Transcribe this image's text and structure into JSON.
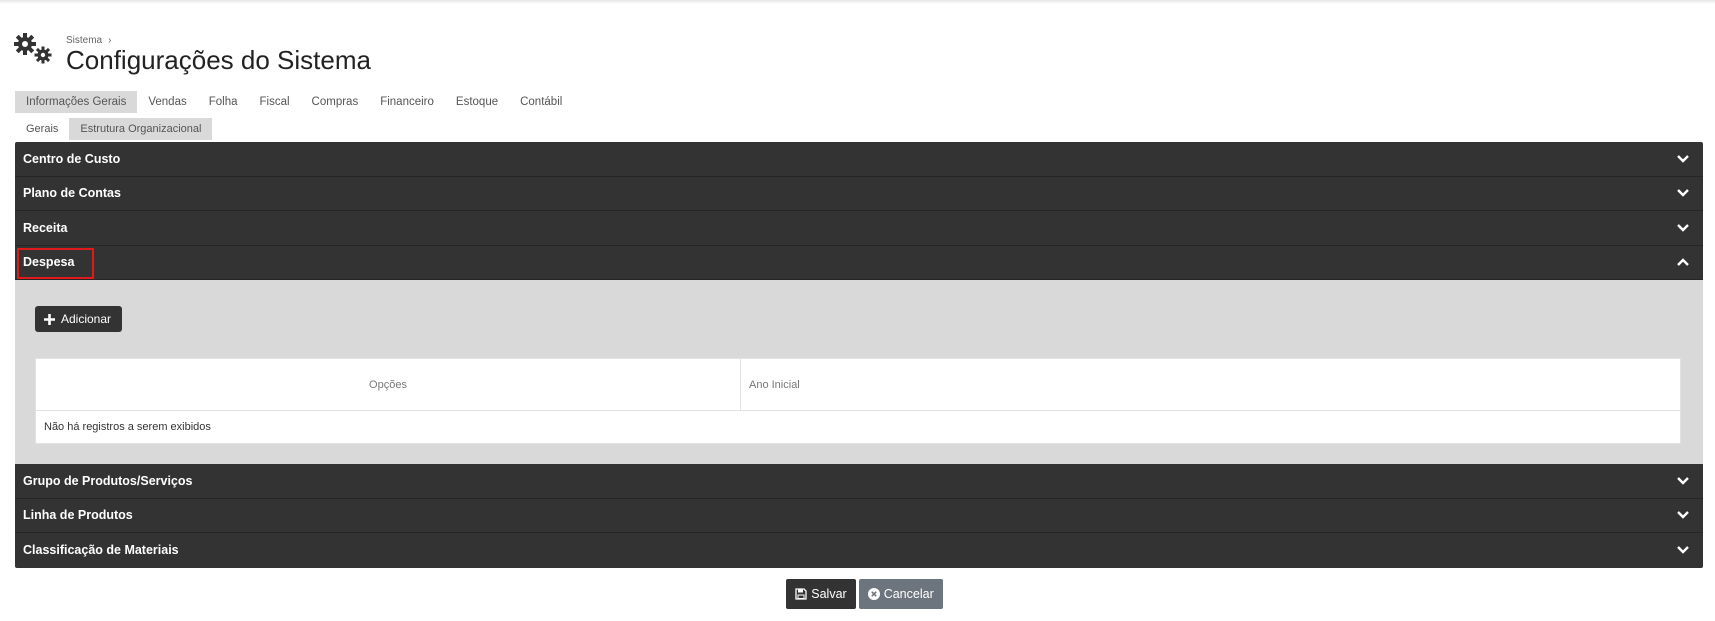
{
  "header": {
    "breadcrumb": "Sistema",
    "title": "Configurações do Sistema",
    "icon": "gears-icon"
  },
  "tabs": [
    {
      "label": "Informações Gerais",
      "active": true
    },
    {
      "label": "Vendas",
      "active": false
    },
    {
      "label": "Folha",
      "active": false
    },
    {
      "label": "Fiscal",
      "active": false
    },
    {
      "label": "Compras",
      "active": false
    },
    {
      "label": "Financeiro",
      "active": false
    },
    {
      "label": "Estoque",
      "active": false
    },
    {
      "label": "Contábil",
      "active": false
    }
  ],
  "subtabs": [
    {
      "label": "Gerais",
      "active": false
    },
    {
      "label": "Estrutura Organizacional",
      "active": true
    }
  ],
  "accordion": {
    "sections": [
      {
        "title": "Centro de Custo",
        "expanded": false
      },
      {
        "title": "Plano de Contas",
        "expanded": false
      },
      {
        "title": "Receita",
        "expanded": false
      },
      {
        "title": "Despesa",
        "expanded": true,
        "highlighted": true
      },
      {
        "title": "Grupo de Produtos/Serviços",
        "expanded": false
      },
      {
        "title": "Linha de Produtos",
        "expanded": false
      },
      {
        "title": "Classificação de Materiais",
        "expanded": false
      }
    ],
    "expanded_panel": {
      "add_label": "Adicionar",
      "columns": [
        "Opções",
        "Ano Inicial"
      ],
      "empty_message": "Não há registros a serem exibidos"
    }
  },
  "footer": {
    "save_label": "Salvar",
    "cancel_label": "Cancelar"
  },
  "colors": {
    "dark": "#333333",
    "panel": "#d9d9d9",
    "highlight": "#e01a1a",
    "cancel": "#6c757d"
  }
}
